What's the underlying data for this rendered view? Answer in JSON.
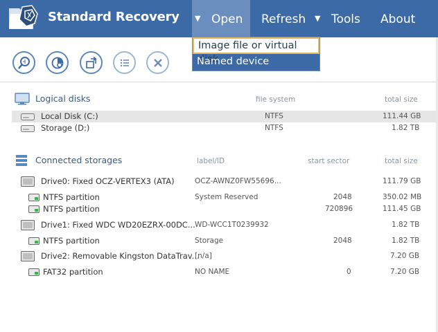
{
  "app": {
    "title": "Standard Recovery"
  },
  "menu": {
    "open": "Open",
    "refresh": "Refresh",
    "tools": "Tools",
    "about": "About"
  },
  "open_menu": {
    "items": [
      "Image file or virtual disk",
      "Named device"
    ]
  },
  "toolbar": {
    "buttons": [
      "search-icon",
      "scan-icon",
      "recover-icon",
      "list-icon",
      "close-icon"
    ]
  },
  "logical_disks": {
    "title": "Logical disks",
    "col_fs": "file system",
    "col_size": "total size",
    "rows": [
      {
        "name": "Local Disk (C:)",
        "fs": "NTFS",
        "size": "111.44 GB"
      },
      {
        "name": "Storage (D:)",
        "fs": "NTFS",
        "size": "1.82 TB"
      }
    ]
  },
  "storages": {
    "title": "Connected storages",
    "col_label": "label/ID",
    "col_sector": "start sector",
    "col_size": "total size",
    "rows": [
      {
        "name": "Drive0: Fixed OCZ-VERTEX3 (ATA)",
        "label": "OCZ-AWNZ0FW55696...",
        "sector": "",
        "size": "111.79 GB"
      },
      {
        "name": "NTFS partition",
        "label": "System Reserved",
        "sector": "2048",
        "size": "350.02 MB"
      },
      {
        "name": "NTFS partition",
        "label": "",
        "sector": "720896",
        "size": "111.45 GB"
      },
      {
        "name": "Drive1: Fixed WDC WD20EZRX-00DC...",
        "label": "WD-WCC1T0239932",
        "sector": "",
        "size": "1.82 TB"
      },
      {
        "name": "NTFS partition",
        "label": "Storage",
        "sector": "2048",
        "size": "1.82 TB"
      },
      {
        "name": "Drive2: Removable Kingston DataTrav...",
        "label": "[n/a]",
        "sector": "",
        "size": "7.20 GB"
      },
      {
        "name": "FAT32 partition",
        "label": "NO NAME",
        "sector": "0",
        "size": "7.20 GB"
      }
    ]
  }
}
